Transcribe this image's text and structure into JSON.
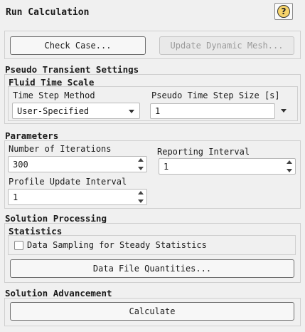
{
  "window": {
    "title": "Run Calculation",
    "help_glyph": "?"
  },
  "buttons": {
    "check_case": "Check Case...",
    "update_dynamic_mesh": "Update Dynamic Mesh...",
    "data_file_quantities": "Data File Quantities...",
    "calculate": "Calculate"
  },
  "pseudo_transient": {
    "title": "Pseudo Transient Settings",
    "fluid_time_scale": {
      "title": "Fluid Time Scale",
      "time_step_method_label": "Time Step Method",
      "time_step_method_value": "User-Specified",
      "pseudo_time_step_label": "Pseudo Time Step Size [s]",
      "pseudo_time_step_value": "1"
    }
  },
  "parameters": {
    "title": "Parameters",
    "num_iterations_label": "Number of Iterations",
    "num_iterations_value": "300",
    "reporting_interval_label": "Reporting Interval",
    "reporting_interval_value": "1",
    "profile_update_label": "Profile Update Interval",
    "profile_update_value": "1"
  },
  "solution_processing": {
    "title": "Solution Processing",
    "statistics_title": "Statistics",
    "data_sampling_label": "Data Sampling for Steady Statistics",
    "data_sampling_checked": false
  },
  "solution_advancement": {
    "title": "Solution Advancement"
  },
  "colors": {
    "panel_bg": "#f0f0f0",
    "help_icon": "#f6d36a",
    "field_bg": "#ffffff"
  }
}
